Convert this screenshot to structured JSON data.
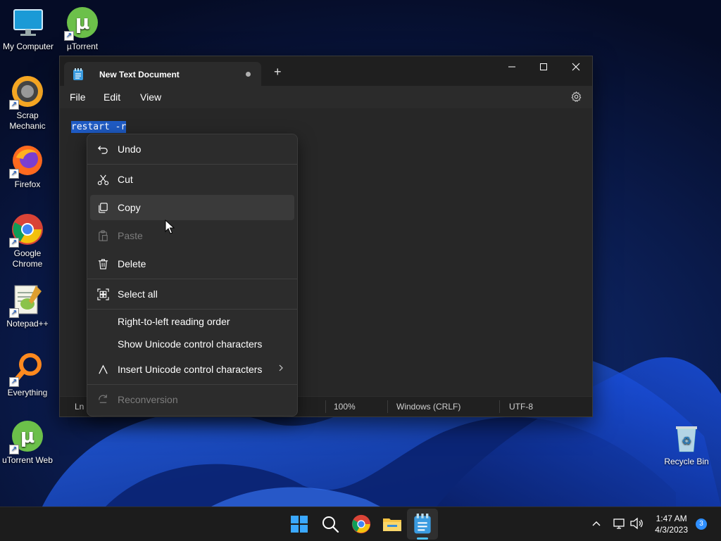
{
  "desktop": {
    "icons": [
      {
        "label": "My Computer"
      },
      {
        "label": "µTorrent"
      },
      {
        "label": "Scrap Mechanic"
      },
      {
        "label": "Firefox"
      },
      {
        "label": "Google Chrome"
      },
      {
        "label": "Notepad++"
      },
      {
        "label": "Everything"
      },
      {
        "label": "uTorrent Web"
      },
      {
        "label": "Recycle Bin"
      }
    ]
  },
  "notepad": {
    "tab_title": "New Text Document",
    "new_tab_label": "+",
    "menu": {
      "file": "File",
      "edit": "Edit",
      "view": "View"
    },
    "content": "restart -r",
    "status": {
      "ln": "Ln",
      "zoom": "100%",
      "line_ending": "Windows (CRLF)",
      "encoding": "UTF-8"
    }
  },
  "context_menu": {
    "undo": "Undo",
    "cut": "Cut",
    "copy": "Copy",
    "paste": "Paste",
    "delete": "Delete",
    "select_all": "Select all",
    "rtl": "Right-to-left reading order",
    "show_unicode": "Show Unicode control characters",
    "insert_unicode": "Insert Unicode control characters",
    "reconversion": "Reconversion"
  },
  "taskbar": {
    "time": "1:47 AM",
    "date": "4/3/2023",
    "notification_count": "3"
  },
  "colors": {
    "selection": "#1f5bc4",
    "accent": "#4cc2ff",
    "menu_bg": "#2c2c2c",
    "window_bg": "#272727"
  }
}
